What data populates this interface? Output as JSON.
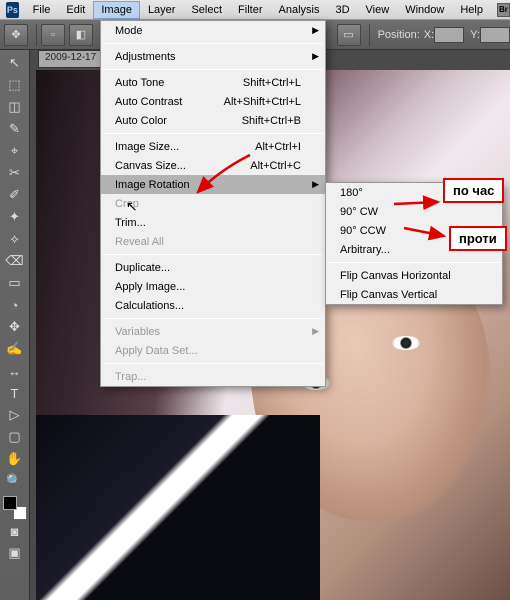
{
  "menubar": {
    "items": [
      "File",
      "Edit",
      "Image",
      "Layer",
      "Select",
      "Filter",
      "Analysis",
      "3D",
      "View",
      "Window",
      "Help"
    ],
    "active_index": 2,
    "br_label": "Br"
  },
  "options": {
    "position_label": "Position:",
    "x_label": "X:",
    "y_label": "Y:"
  },
  "doc_tab": "2009-12-17",
  "dropdown": {
    "sections": [
      [
        {
          "label": "Mode",
          "arrow": true
        }
      ],
      [
        {
          "label": "Adjustments",
          "arrow": true
        }
      ],
      [
        {
          "label": "Auto Tone",
          "shortcut": "Shift+Ctrl+L"
        },
        {
          "label": "Auto Contrast",
          "shortcut": "Alt+Shift+Ctrl+L"
        },
        {
          "label": "Auto Color",
          "shortcut": "Shift+Ctrl+B"
        }
      ],
      [
        {
          "label": "Image Size...",
          "shortcut": "Alt+Ctrl+I"
        },
        {
          "label": "Canvas Size...",
          "shortcut": "Alt+Ctrl+C"
        },
        {
          "label": "Image Rotation",
          "arrow": true,
          "hover": true
        },
        {
          "label": "Crop",
          "disabled": true
        },
        {
          "label": "Trim..."
        },
        {
          "label": "Reveal All",
          "disabled": true
        }
      ],
      [
        {
          "label": "Duplicate..."
        },
        {
          "label": "Apply Image..."
        },
        {
          "label": "Calculations..."
        }
      ],
      [
        {
          "label": "Variables",
          "arrow": true,
          "disabled": true
        },
        {
          "label": "Apply Data Set...",
          "disabled": true
        }
      ],
      [
        {
          "label": "Trap...",
          "disabled": true
        }
      ]
    ]
  },
  "submenu": {
    "sections": [
      [
        {
          "label": "180°"
        },
        {
          "label": "90° CW"
        },
        {
          "label": "90° CCW"
        },
        {
          "label": "Arbitrary..."
        }
      ],
      [
        {
          "label": "Flip Canvas Horizontal"
        },
        {
          "label": "Flip Canvas Vertical"
        }
      ]
    ]
  },
  "annotations": {
    "cw": "по час",
    "ccw": "проти"
  },
  "tools": [
    "↖",
    "⬚",
    "◫",
    "✎",
    "⌖",
    "✂",
    "✐",
    "✦",
    "⟡",
    "⌫",
    "▭",
    "◔",
    "✥",
    "✍",
    "↔",
    "T",
    "▷",
    "▢",
    "✋",
    "🔍"
  ],
  "ps_label": "Ps"
}
